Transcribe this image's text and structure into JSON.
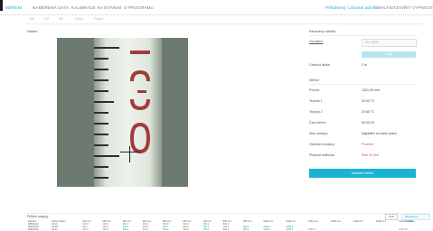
{
  "nav": {
    "items": [
      "MĚŘENÍ",
      "NAMĚŘENÁ DATA",
      "KALIBRACE",
      "NASTAVENÍ",
      "O PROGRAMU"
    ],
    "user_label": "Přihlášený: Uživatel admin",
    "right_items": [
      "ODHLÁSIT",
      "ZAVŘÍT",
      "VYPNOUT"
    ]
  },
  "subtabs": [
    "1M",
    "2M",
    "3M",
    "Délka",
    "Posun"
  ],
  "camera_panel": {
    "title": "Náhled"
  },
  "params": {
    "title": "Parametry měřidla",
    "fields": [
      {
        "label": "Označení",
        "value": "DM_00301"
      }
    ],
    "button_light": "Uložit",
    "total_length_label": "Celková délka",
    "total_length_value": "2 m"
  },
  "status": {
    "title": "Měření",
    "rows": [
      {
        "label": "Poloha",
        "value": "1331.29 mm",
        "red": false
      },
      {
        "label": "Teplota 1",
        "value": "20.93 °C",
        "red": false
      },
      {
        "label": "Teplota 2",
        "value": "20.65 °C",
        "red": false
      },
      {
        "label": "Čas měření",
        "value": "00:00:23",
        "red": false
      },
      {
        "label": "Stav analýzy",
        "value": "Najíždění na další pozici",
        "red": false
      },
      {
        "label": "Výsledek analýzy",
        "value": "Probíhá",
        "red": true
      },
      {
        "label": "Platnost kalibrace",
        "value": "Platí 22 dnů",
        "red": true
      }
    ],
    "button_main": "Zastavit měření"
  },
  "results": {
    "title": "Průběh analýzy",
    "btn_left": "Graf",
    "btn_right": "Naměřené hodnoty",
    "header": [
      "Záznam",
      "Počet měření",
      "100 mm",
      "200 mm",
      "300 mm",
      "400 mm",
      "500 mm",
      "600 mm",
      "700 mm",
      "800 mm",
      "900 mm",
      "1000 mm",
      "1100 mm",
      "1200 mm",
      "1300 mm",
      "1400 mm",
      "1500 mm",
      "Celková délka"
    ],
    "rows": [
      {
        "cells": [
          "ZPR4C02",
          "18:13",
          "100.0",
          "199.9",
          "300.1",
          "400.2",
          "500.0",
          "600.0",
          "699.9",
          "800.0",
          "",
          "",
          "",
          "",
          "",
          "",
          "",
          ""
        ],
        "cls": [
          "",
          "",
          "g",
          "r",
          "g",
          "r",
          "g",
          "g",
          "g",
          "g",
          "",
          "",
          "",
          "",
          "",
          "",
          "",
          ""
        ]
      },
      {
        "cells": [
          "ZPR4C02",
          "18:18",
          "99.9",
          "200.1",
          "300.0",
          "399.9",
          "500.1",
          "600.0",
          "700.1",
          "799.9",
          "900.0",
          "1000.1",
          "1099.9",
          "",
          "",
          "",
          "",
          ""
        ],
        "cls": [
          "",
          "",
          "r",
          "r",
          "g",
          "r",
          "g",
          "r",
          "g",
          "r",
          "g",
          "g",
          "g",
          "",
          "",
          "",
          "",
          ""
        ]
      },
      {
        "cells": [
          "ZPR4C02",
          "18:22",
          "100.0",
          "200.0",
          "300.0",
          "400.1",
          "500.0",
          "600.0",
          "700.0",
          "800.0",
          "900.1",
          "1000.0",
          "1100.0",
          "1200.0",
          "",
          "",
          "",
          "1331.29"
        ],
        "cls": [
          "",
          "",
          "g",
          "g",
          "g",
          "g",
          "g",
          "g",
          "g",
          "g",
          "g",
          "g",
          "g",
          "g",
          "",
          "",
          "",
          "g"
        ]
      }
    ]
  }
}
